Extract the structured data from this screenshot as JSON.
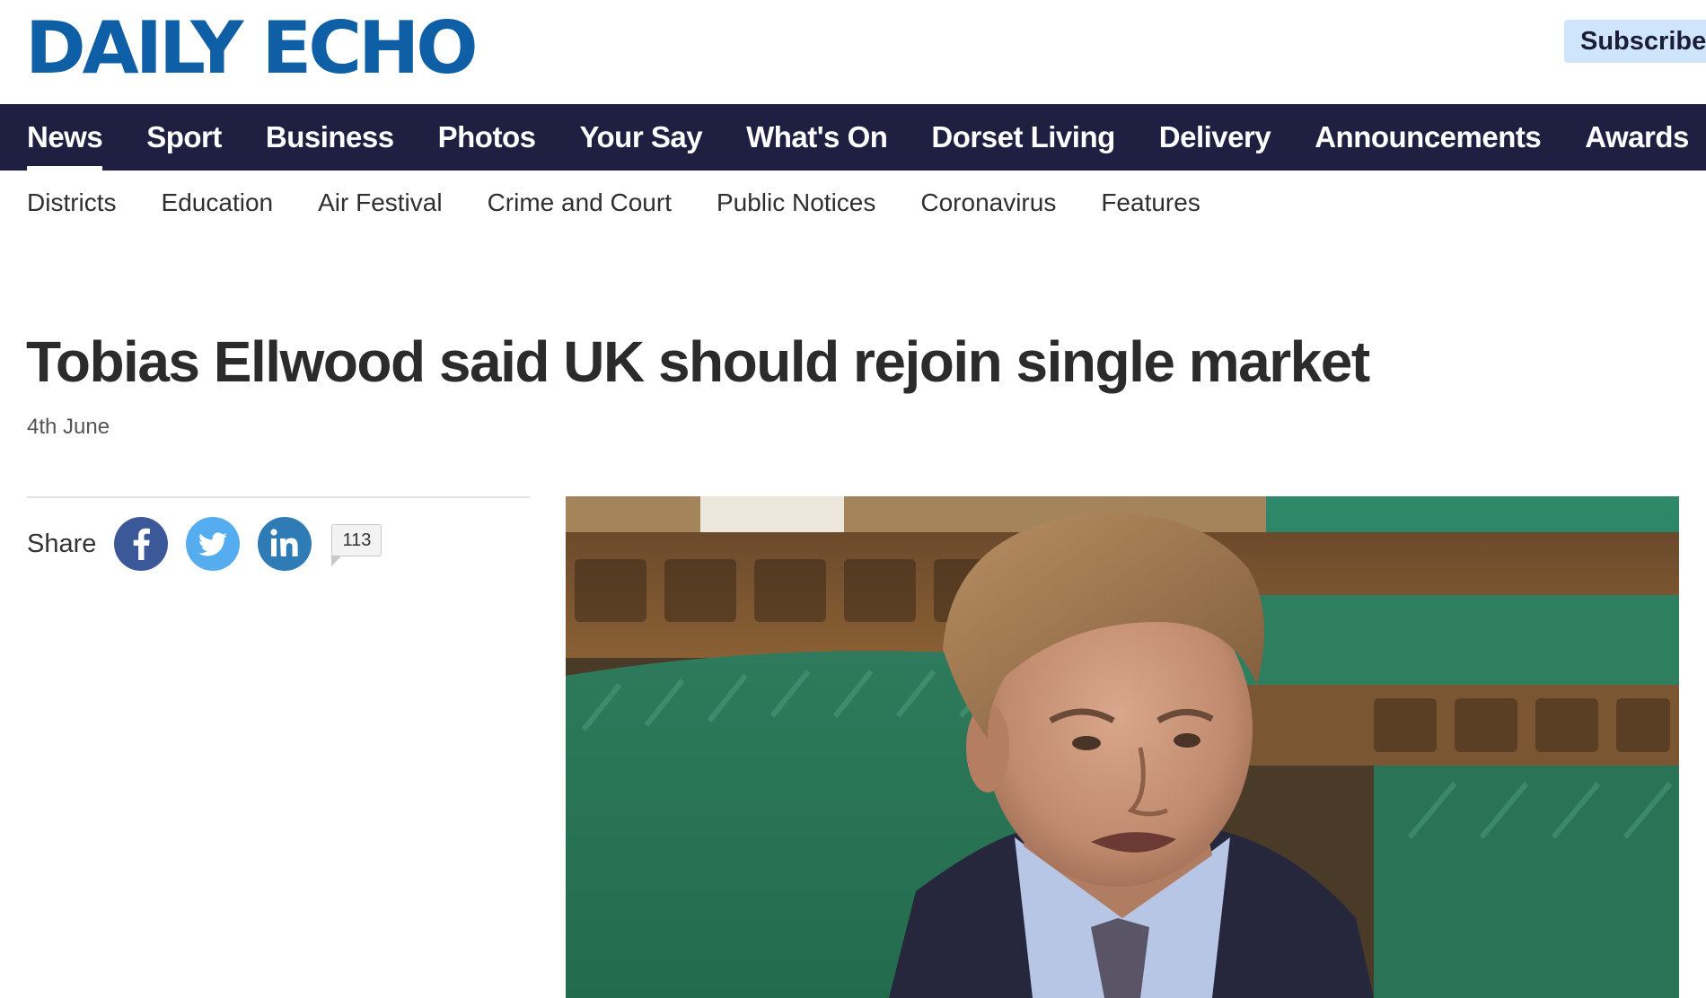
{
  "header": {
    "logo_text": "DAILY ECHO",
    "subscribe_label": "Subscribe"
  },
  "primary_nav": {
    "items": [
      "News",
      "Sport",
      "Business",
      "Photos",
      "Your Say",
      "What's On",
      "Dorset Living",
      "Delivery",
      "Announcements",
      "Awards"
    ],
    "active": "News"
  },
  "secondary_nav": {
    "items": [
      "Districts",
      "Education",
      "Air Festival",
      "Crime and Court",
      "Public Notices",
      "Coronavirus",
      "Features"
    ]
  },
  "article": {
    "headline": "Tobias Ellwood said UK should rejoin single market",
    "date": "4th June"
  },
  "share": {
    "label": "Share",
    "networks": [
      "facebook-icon",
      "twitter-icon",
      "linkedin-icon"
    ],
    "comment_count": "113"
  },
  "colors": {
    "brand_blue": "#0f5fa6",
    "nav_background": "#1f1f42",
    "subscribe_background": "#cfe6fa",
    "facebook": "#3b5998",
    "twitter": "#55acee",
    "linkedin": "#2e7bb6"
  }
}
